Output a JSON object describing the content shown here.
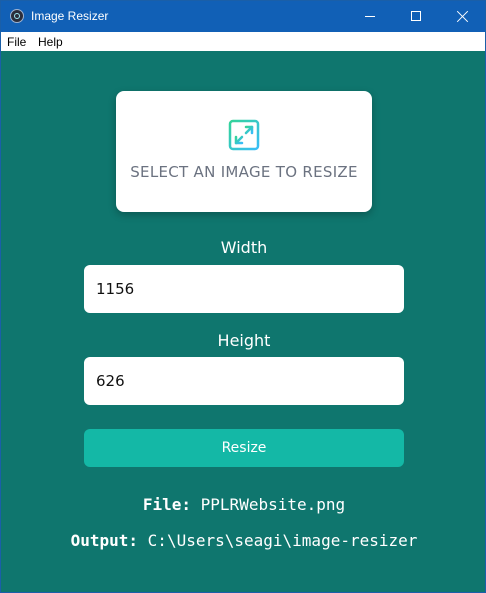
{
  "window": {
    "title": "Image Resizer",
    "icon": "electron-icon"
  },
  "menu": {
    "items": [
      {
        "label": "File"
      },
      {
        "label": "Help"
      }
    ]
  },
  "select_card": {
    "icon": "expand-icon",
    "label": "SELECT AN IMAGE TO RESIZE"
  },
  "width": {
    "label": "Width",
    "value": "1156"
  },
  "height": {
    "label": "Height",
    "value": "626"
  },
  "resize_button": {
    "label": "Resize"
  },
  "file_info": {
    "key": "File:",
    "value": "PPLRWebsite.png"
  },
  "output_info": {
    "key": "Output:",
    "value": "C:\\Users\\seagi\\image-resizer"
  },
  "colors": {
    "background": "#0f766e",
    "titlebar": "#1160b6",
    "button": "#14b8a6",
    "icon_gradient_start": "#34d399",
    "icon_gradient_end": "#38bdf8"
  }
}
